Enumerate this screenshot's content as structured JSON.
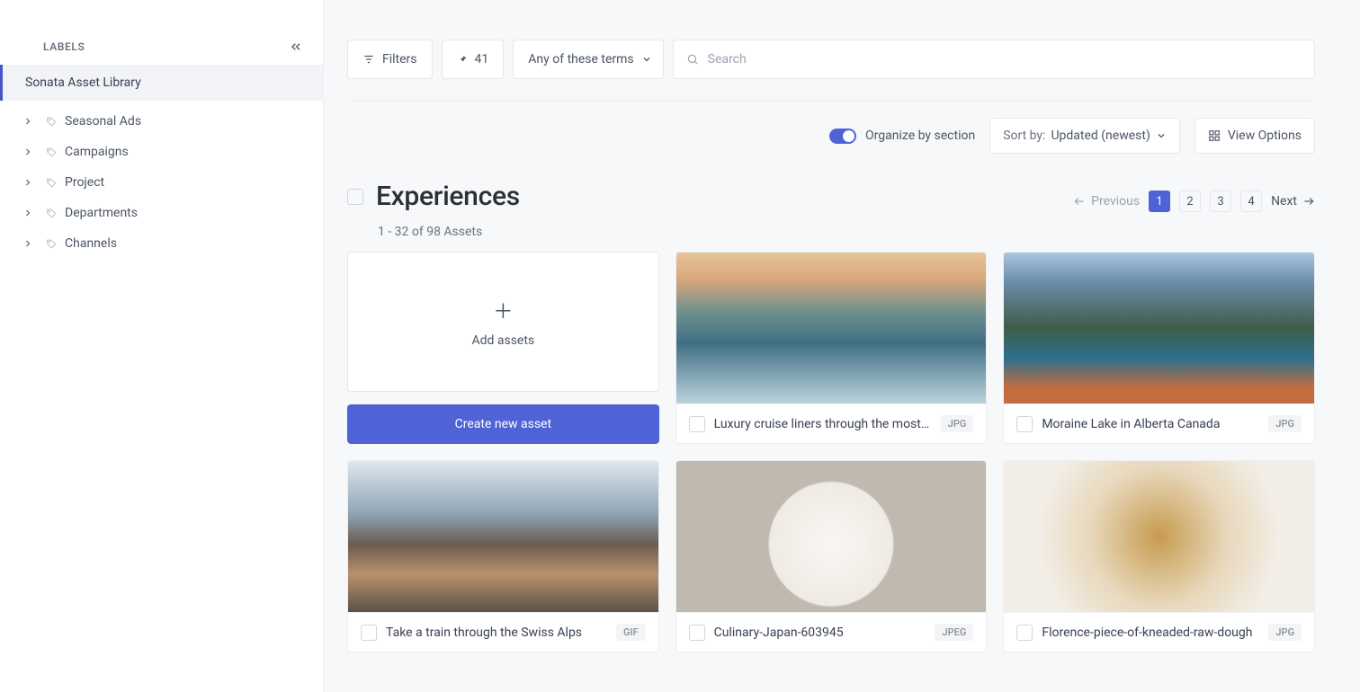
{
  "sidebar": {
    "header": "LABELS",
    "library": "Sonata Asset Library",
    "items": [
      {
        "label": "Seasonal Ads"
      },
      {
        "label": "Campaigns"
      },
      {
        "label": "Project"
      },
      {
        "label": "Departments"
      },
      {
        "label": "Channels"
      }
    ]
  },
  "toolbar": {
    "filters": "Filters",
    "pinned_count": "41",
    "terms_label": "Any of these terms",
    "search_placeholder": "Search"
  },
  "controls": {
    "organize_label": "Organize by section",
    "sort_prefix": "Sort by:",
    "sort_value": "Updated (newest)",
    "view_label": "View Options"
  },
  "section": {
    "title": "Experiences",
    "subtitle": "1 - 32 of 98 Assets"
  },
  "pagination": {
    "prev": "Previous",
    "next": "Next",
    "pages": [
      "1",
      "2",
      "3",
      "4"
    ],
    "current": "1"
  },
  "add_tile": {
    "label": "Add assets",
    "create_btn": "Create new asset"
  },
  "assets": [
    {
      "title": "Luxury cruise liners through the most s…",
      "type": "JPG",
      "thumb": "t1"
    },
    {
      "title": "Moraine Lake in Alberta Canada",
      "type": "JPG",
      "thumb": "t2"
    },
    {
      "title": "Take a train through the Swiss Alps",
      "type": "GIF",
      "thumb": "t3"
    },
    {
      "title": "Culinary-Japan-603945",
      "type": "JPEG",
      "thumb": "t4"
    },
    {
      "title": "Florence-piece-of-kneaded-raw-dough",
      "type": "JPG",
      "thumb": "t5"
    }
  ]
}
